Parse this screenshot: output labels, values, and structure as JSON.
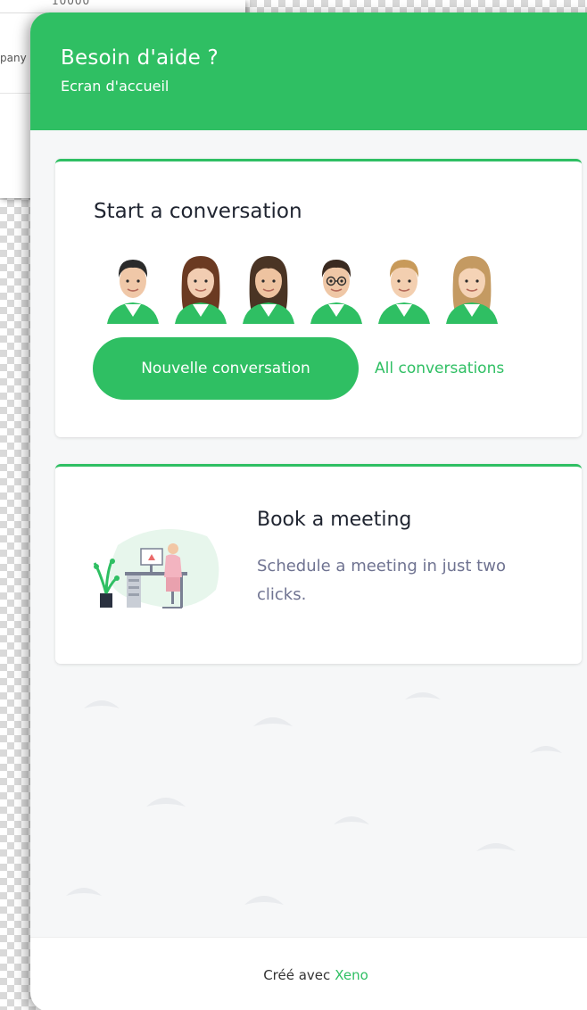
{
  "background": {
    "top_text": "10000",
    "fragment": "pany"
  },
  "header": {
    "title": "Besoin d'aide ?",
    "subtitle": "Ecran d'accueil"
  },
  "conversation_card": {
    "title": "Start a conversation",
    "avatars": [
      "agent-avatar-1",
      "agent-avatar-2",
      "agent-avatar-3",
      "agent-avatar-4",
      "agent-avatar-5",
      "agent-avatar-6"
    ],
    "new_button_label": "Nouvelle conversation",
    "all_link_label": "All conversations"
  },
  "meeting_card": {
    "title": "Book a meeting",
    "description": "Schedule a meeting in just two clicks."
  },
  "footer": {
    "prefix": "Créé avec",
    "brand": "Xeno"
  },
  "colors": {
    "accent": "#2fbf63",
    "muted_text": "#6f7391"
  }
}
